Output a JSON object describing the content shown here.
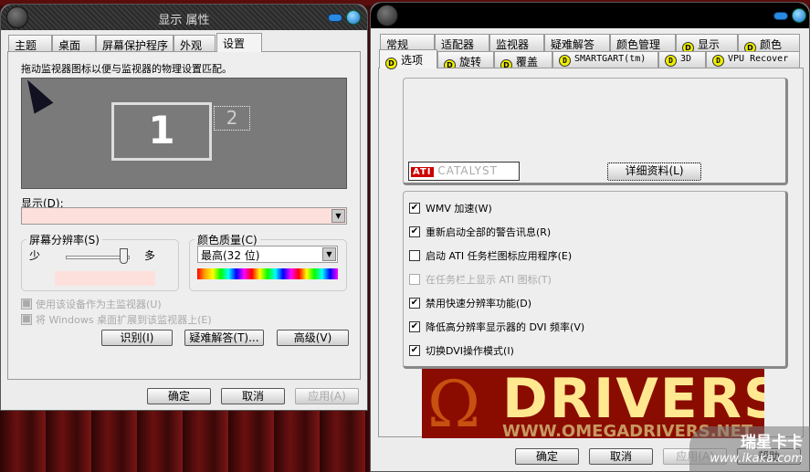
{
  "left_window": {
    "title": "显示 属性",
    "tabs": [
      "主题",
      "桌面",
      "屏幕保护程序",
      "外观",
      "设置"
    ],
    "active_tab": "设置",
    "instruction": "拖动监视器图标以便与监视器的物理设置匹配。",
    "monitors": [
      "1",
      "2"
    ],
    "display_label": "显示(D):",
    "display_value": "",
    "resolution": {
      "label": "屏幕分辨率(S)",
      "less": "少",
      "more": "多",
      "slider_value": 1.0
    },
    "color_quality": {
      "label": "颜色质量(C)",
      "value": "最高(32 位)"
    },
    "checkboxes": [
      {
        "label": "使用该设备作为主监视器(U)",
        "checked": true,
        "enabled": false
      },
      {
        "label": "将 Windows 桌面扩展到该监视器上(E)",
        "checked": true,
        "enabled": false
      }
    ],
    "buttons": {
      "identify": "识别(I)",
      "troubleshoot": "疑难解答(T)...",
      "advanced": "高级(V)"
    },
    "footer": {
      "ok": "确定",
      "cancel": "取消",
      "apply": "应用(A)"
    }
  },
  "right_window": {
    "title": "",
    "tabs_row1": [
      {
        "label": "常规",
        "icon": false
      },
      {
        "label": "适配器",
        "icon": false
      },
      {
        "label": "监视器",
        "icon": false
      },
      {
        "label": "疑难解答",
        "icon": false
      },
      {
        "label": "颜色管理",
        "icon": false
      },
      {
        "label": "显示",
        "icon": true
      },
      {
        "label": "颜色",
        "icon": true
      }
    ],
    "tabs_row2": [
      {
        "label": "选项",
        "icon": true
      },
      {
        "label": "旋转",
        "icon": true
      },
      {
        "label": "覆盖",
        "icon": true
      },
      {
        "label": "SMARTGART(tm)",
        "icon": true
      },
      {
        "label": "3D",
        "icon": true
      },
      {
        "label": "VPU Recover",
        "icon": true
      }
    ],
    "active_tab": "选项",
    "catalyst_logo": "ATI CATALYST",
    "details_button": "详细资料(L)",
    "options": [
      {
        "label": "WMV 加速(W)",
        "checked": true,
        "enabled": true
      },
      {
        "label": "重新启动全部的警告讯息(R)",
        "checked": true,
        "enabled": true
      },
      {
        "label": "启动 ATI 任务栏图标应用程序(E)",
        "checked": false,
        "enabled": true
      },
      {
        "label": "在任务栏上显示 ATI 图标(T)",
        "checked": false,
        "enabled": false
      },
      {
        "label": "禁用快速分辨率功能(D)",
        "checked": true,
        "enabled": true
      },
      {
        "label": "降低高分辨率显示器的 DVI 频率(V)",
        "checked": true,
        "enabled": true
      },
      {
        "label": "切换DVI操作模式(I)",
        "checked": true,
        "enabled": true
      }
    ],
    "banner": {
      "title": "DRIVERS",
      "url": "WWW.OMEGADRIVERS.NET"
    },
    "footer": {
      "ok": "确定",
      "cancel": "取消",
      "apply": "应用(A)",
      "help": "帮助"
    }
  },
  "watermark": {
    "name": "瑞星卡卡",
    "url": "www.ikaka.com"
  }
}
